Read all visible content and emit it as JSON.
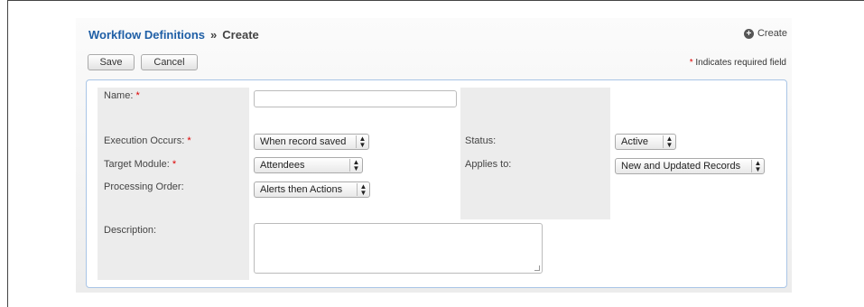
{
  "header": {
    "crumb": "Workflow Definitions",
    "separator": "»",
    "current": "Create",
    "create_link": "Create"
  },
  "toolbar": {
    "save_label": "Save",
    "cancel_label": "Cancel",
    "required_note": "Indicates required field",
    "required_star": "*"
  },
  "form": {
    "name_label": "Name:",
    "execution_label": "Execution Occurs:",
    "execution_value": "When record saved",
    "target_label": "Target Module:",
    "target_value": "Attendees",
    "processing_label": "Processing Order:",
    "processing_value": "Alerts then Actions",
    "description_label": "Description:",
    "status_label": "Status:",
    "status_value": "Active",
    "applies_label": "Applies to:",
    "applies_value": "New and Updated Records",
    "name_value": "",
    "description_value": ""
  },
  "icons": {
    "create": "plus-circle-icon",
    "select_arrows": "updown-arrows-icon"
  }
}
